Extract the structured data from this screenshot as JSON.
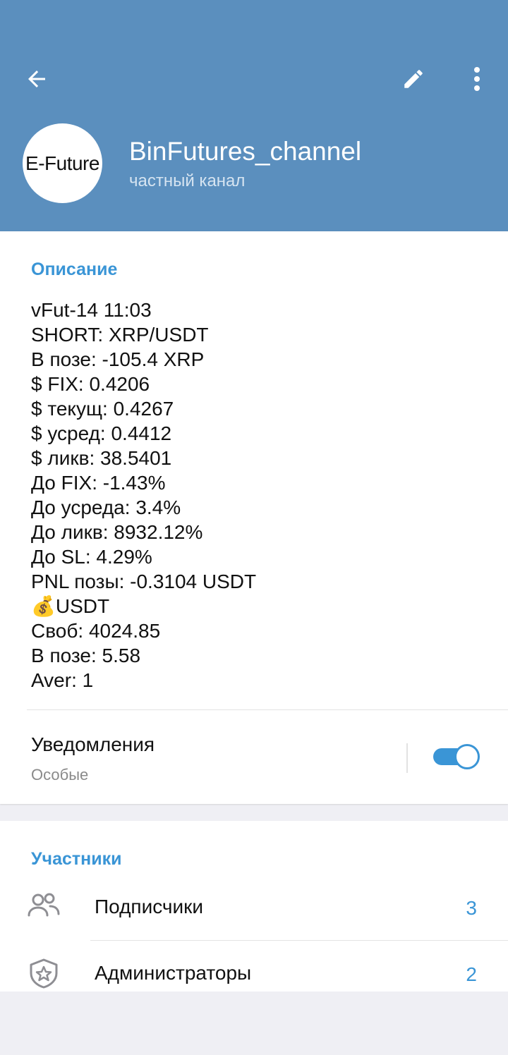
{
  "header": {
    "title": "BinFutures_channel",
    "subtitle": "частный канал",
    "avatar_text": "E-Future",
    "background_color": "#5b8fbe",
    "icons": {
      "back": "arrow-left-icon",
      "edit": "pencil-icon",
      "more": "more-vertical-icon"
    }
  },
  "description": {
    "heading": "Описание",
    "lines": [
      "vFut-14 11:03",
      "SHORT: XRP/USDT",
      "В позе: -105.4 XRP",
      "$ FIX: 0.4206",
      "$ текущ: 0.4267",
      "$ усред: 0.4412",
      "$ ликв: 38.5401",
      "До FIX: -1.43%",
      "До усреда: 3.4%",
      "До ликв: 8932.12%",
      "До SL: 4.29%",
      "PNL позы: -0.3104 USDT",
      "💰USDT",
      "Своб: 4024.85",
      "В позе: 5.58",
      "Aver: 1"
    ]
  },
  "notifications": {
    "label": "Уведомления",
    "value": "Особые",
    "enabled": true,
    "accent_color": "#3a95d6"
  },
  "members": {
    "heading": "Участники",
    "items": [
      {
        "label": "Подписчики",
        "count": "3",
        "icon": "users-icon"
      },
      {
        "label": "Администраторы",
        "count": "2",
        "icon": "shield-star-icon"
      }
    ]
  }
}
